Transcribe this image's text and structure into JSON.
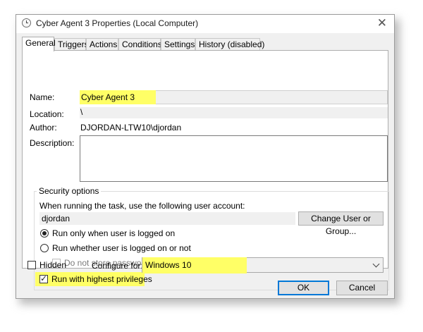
{
  "window": {
    "title": "Cyber Agent 3 Properties (Local Computer)",
    "close_glyph": "✕"
  },
  "tabs": [
    {
      "label": "General"
    },
    {
      "label": "Triggers"
    },
    {
      "label": "Actions"
    },
    {
      "label": "Conditions"
    },
    {
      "label": "Settings"
    },
    {
      "label": "History (disabled)"
    }
  ],
  "general": {
    "name_label": "Name:",
    "name_value": "Cyber Agent 3",
    "location_label": "Location:",
    "location_value": "\\",
    "author_label": "Author:",
    "author_value": "DJORDAN-LTW10\\djordan",
    "description_label": "Description:",
    "description_value": ""
  },
  "security": {
    "group_title": "Security options",
    "account_prompt": "When running the task, use the following user account:",
    "user_account": "djordan",
    "change_button": "Change User or Group...",
    "radio_logged_on": "Run only when user is logged on",
    "radio_whether": "Run whether user is logged on or not",
    "no_store_password": "Do not store password.  The task will only have access to local computer resources.",
    "highest_privileges": "Run with highest privileges"
  },
  "footer": {
    "hidden_label": "Hidden",
    "configure_label": "Configure for:",
    "configure_value": "Windows 10",
    "ok_button": "OK",
    "cancel_button": "Cancel"
  },
  "colors": {
    "highlight": "#ffff66",
    "accent": "#0078d7"
  }
}
